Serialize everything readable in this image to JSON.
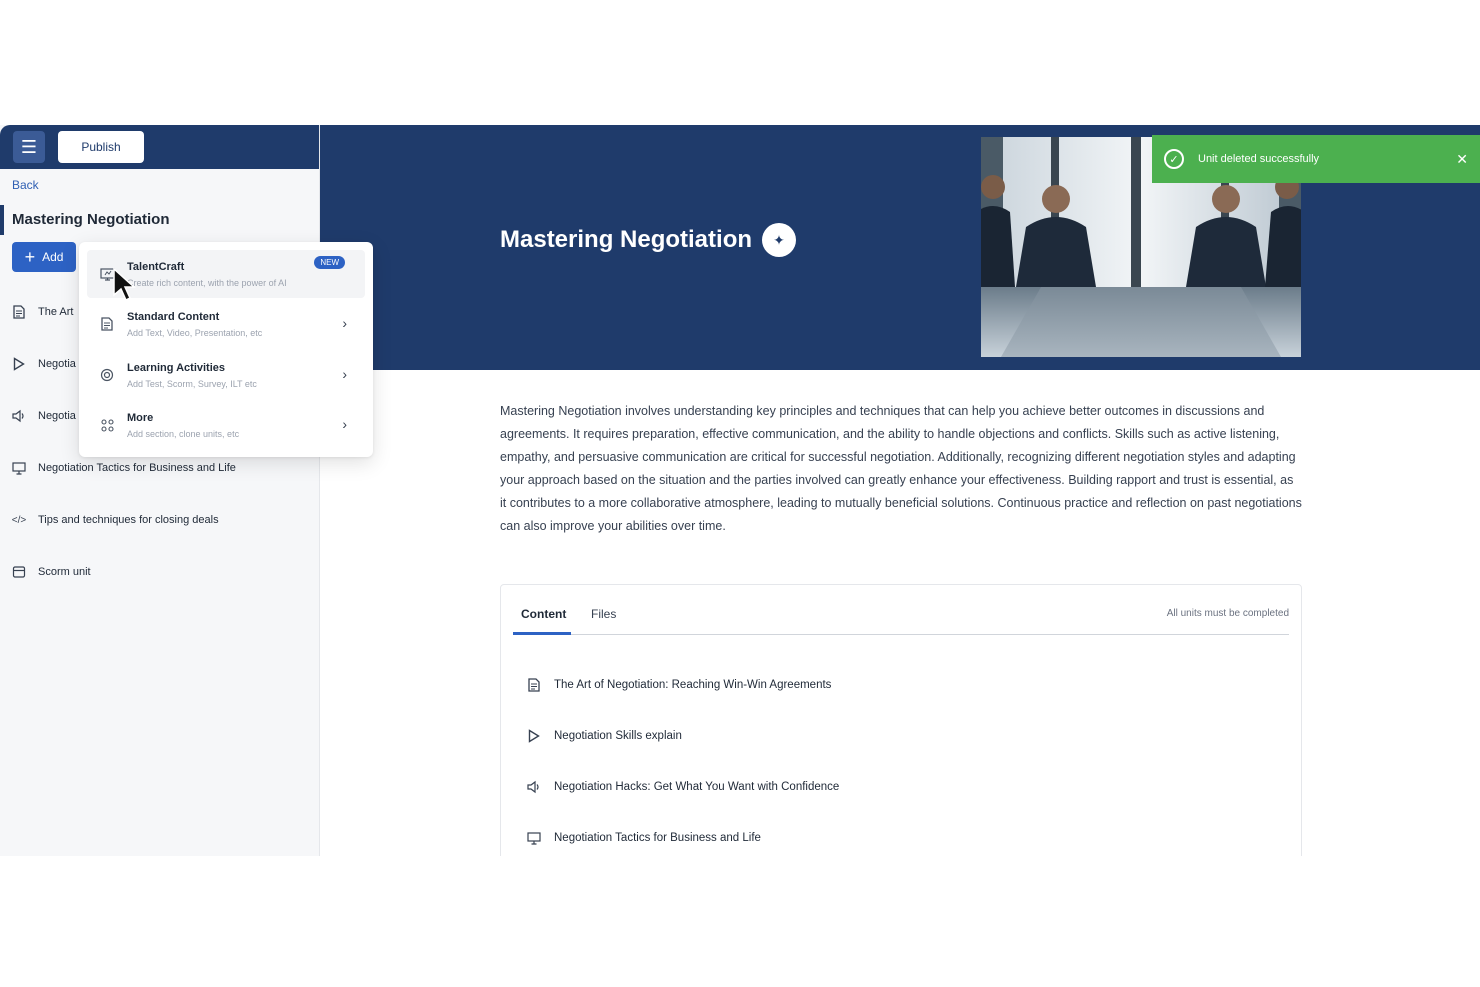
{
  "toolbar": {
    "menu_icon": "menu-icon",
    "publish_label": "Publish"
  },
  "sidebar": {
    "back_label": "Back",
    "course_title": "Mastering Negotiation",
    "add_label": "Add",
    "items": [
      {
        "icon": "document-icon",
        "label": "The Art"
      },
      {
        "icon": "play-icon",
        "label": "Negotia"
      },
      {
        "icon": "speaker-icon",
        "label": "Negotia"
      },
      {
        "icon": "presentation-icon",
        "label": "Negotiation Tactics for Business and Life"
      },
      {
        "icon": "code-icon",
        "label": "Tips and techniques for closing deals"
      },
      {
        "icon": "package-icon",
        "label": "Scorm unit"
      }
    ]
  },
  "add_menu": {
    "items": [
      {
        "icon": "ai-board-icon",
        "title": "TalentCraft",
        "subtitle": "Create rich content, with the power of AI",
        "badge": "NEW"
      },
      {
        "icon": "document-icon",
        "title": "Standard Content",
        "subtitle": "Add Text, Video, Presentation, etc"
      },
      {
        "icon": "target-icon",
        "title": "Learning Activities",
        "subtitle": "Add Test, Scorm, Survey, ILT etc"
      },
      {
        "icon": "grid-icon",
        "title": "More",
        "subtitle": "Add section, clone units, etc"
      }
    ]
  },
  "hero": {
    "title": "Mastering Negotiation",
    "image_alt": "business meeting photo"
  },
  "toast": {
    "message": "Unit deleted successfully",
    "color": "#4cb04f"
  },
  "description": "Mastering Negotiation involves understanding key principles and techniques that can help you achieve better outcomes in discussions and agreements. It requires preparation, effective communication, and the ability to handle objections and conflicts. Skills such as active listening, empathy, and persuasive communication are critical for successful negotiation. Additionally, recognizing different negotiation styles and adapting your approach based on the situation and the parties involved can greatly enhance your effectiveness. Building rapport and trust is essential, as it contributes to a more collaborative atmosphere, leading to mutually beneficial solutions. Continuous practice and reflection on past negotiations can also improve your abilities over time.",
  "content_tabs": {
    "tabs": [
      "Content",
      "Files"
    ],
    "note": "All units must be completed",
    "items": [
      {
        "icon": "document-icon",
        "label": "The Art of Negotiation: Reaching Win-Win Agreements"
      },
      {
        "icon": "play-icon",
        "label": "Negotiation Skills explain"
      },
      {
        "icon": "speaker-icon",
        "label": "Negotiation Hacks: Get What You Want with Confidence"
      },
      {
        "icon": "presentation-icon",
        "label": "Negotiation Tactics for Business and Life"
      }
    ]
  },
  "colors": {
    "brand": "#1f3b6b",
    "accent": "#2d62c4"
  }
}
